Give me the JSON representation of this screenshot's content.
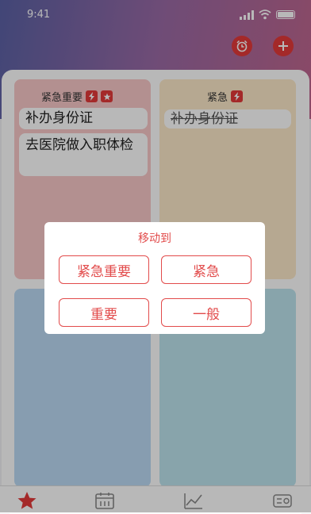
{
  "status_bar": {
    "time": "9:41"
  },
  "icons": {
    "alarm": "alarm-clock-icon",
    "add": "plus-icon",
    "urgent": "lightning-icon",
    "important": "star-icon",
    "tabs": [
      "star-icon",
      "calendar-icon",
      "chart-icon",
      "settings-icon"
    ]
  },
  "colors": {
    "accent": "#e33a3a",
    "q_urgent_important": "#f8c8c8",
    "q_urgent": "#fde9c9",
    "q_important": "#bcdaf4",
    "q_normal": "#bde3ee"
  },
  "quadrants": {
    "urgent_important": {
      "label": "紧急重要",
      "tasks": [
        {
          "text": "补办身份证"
        },
        {
          "text": "去医院做入职体检"
        }
      ]
    },
    "urgent": {
      "label": "紧急",
      "tasks": [
        {
          "text": "补办身份证",
          "done": true
        }
      ]
    }
  },
  "dialog": {
    "title": "移动到",
    "options": [
      "紧急重要",
      "紧急",
      "重要",
      "一般"
    ]
  }
}
